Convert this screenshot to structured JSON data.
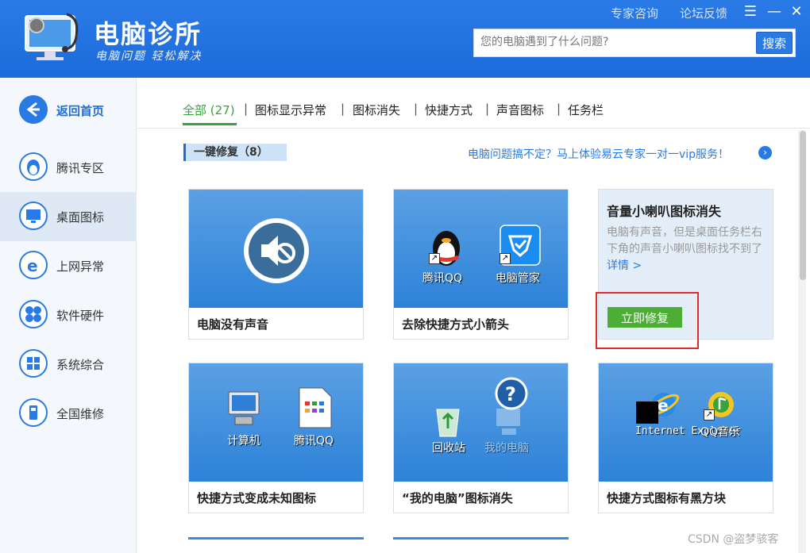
{
  "header": {
    "app_title": "电脑诊所",
    "app_slogan": "电脑问题 轻松解决",
    "top_links": [
      "专家咨询",
      "论坛反馈"
    ],
    "search": {
      "placeholder": "您的电脑遇到了什么问题?",
      "button_label": "搜索"
    }
  },
  "sidebar": {
    "items": [
      {
        "label": "返回首页",
        "icon": "back-arrow-icon"
      },
      {
        "label": "腾讯专区",
        "icon": "qq-penguin-icon"
      },
      {
        "label": "桌面图标",
        "icon": "monitor-icon"
      },
      {
        "label": "上网异常",
        "icon": "ie-icon"
      },
      {
        "label": "软件硬件",
        "icon": "fan-icon"
      },
      {
        "label": "系统综合",
        "icon": "windows-icon"
      },
      {
        "label": "全国维修",
        "icon": "phone-icon"
      }
    ],
    "active_index": 2
  },
  "tabs": [
    {
      "label": "全部 (27)"
    },
    {
      "label": "图标显示异常"
    },
    {
      "label": "图标消失"
    },
    {
      "label": "快捷方式"
    },
    {
      "label": "声音图标"
    },
    {
      "label": "任务栏"
    }
  ],
  "section": {
    "title": "一键修复（8）",
    "vip_link": "电脑问题搞不定？马上体验易云专家一对一vip服务！"
  },
  "cards": [
    {
      "title": "电脑没有声音"
    },
    {
      "title": "去除快捷方式小箭头",
      "icons": [
        "腾讯QQ",
        "电脑管家"
      ]
    },
    {
      "title": "音量小喇叭图标消失",
      "desc": "电脑有声音，但是桌面任务栏右下角的声音小喇叭图标找不到了",
      "more": "详情 >",
      "button": "立即修复"
    },
    {
      "title": "快捷方式变成未知图标",
      "icons": [
        "计算机",
        "腾讯QQ"
      ]
    },
    {
      "title": "“我的电脑”图标消失",
      "icons": [
        "回收站",
        "我的电脑"
      ]
    },
    {
      "title": "快捷方式图标有黑方块",
      "icons": [
        "Internet Explorer",
        "QQ音乐"
      ]
    }
  ],
  "watermark": "CSDN @盗梦骇客",
  "colors": {
    "brand": "#1d6bdc",
    "accent_green": "#3aa23a",
    "fix_button": "#4cae34",
    "highlight_box": "#e12a2a"
  }
}
